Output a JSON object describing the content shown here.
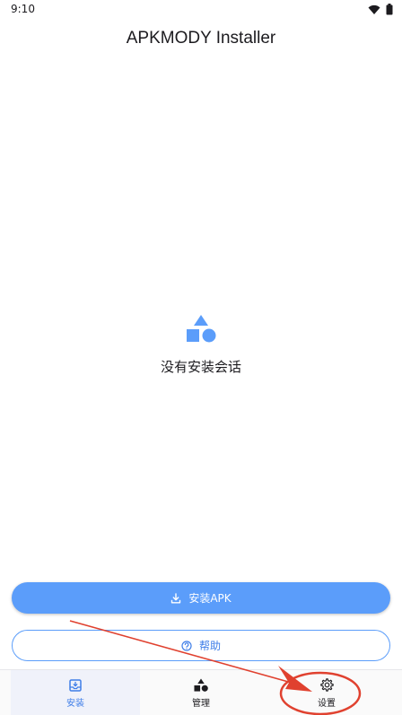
{
  "status": {
    "time": "9:10"
  },
  "header": {
    "title": "APKMODY Installer"
  },
  "empty_state": {
    "icon": "shapes-icon",
    "message": "没有安装会话"
  },
  "actions": {
    "install_label": "安装APK",
    "install_icon": "download-icon",
    "help_label": "帮助",
    "help_icon": "help-circle-icon"
  },
  "nav": {
    "items": [
      {
        "label": "安装",
        "icon": "install-box-icon",
        "active": true
      },
      {
        "label": "管理",
        "icon": "shapes-icon",
        "active": false
      },
      {
        "label": "设置",
        "icon": "gear-icon",
        "active": false
      }
    ]
  },
  "colors": {
    "accent": "#5b9dfa",
    "accent_text": "#3f7ee8",
    "annotation": "#e0412f"
  }
}
